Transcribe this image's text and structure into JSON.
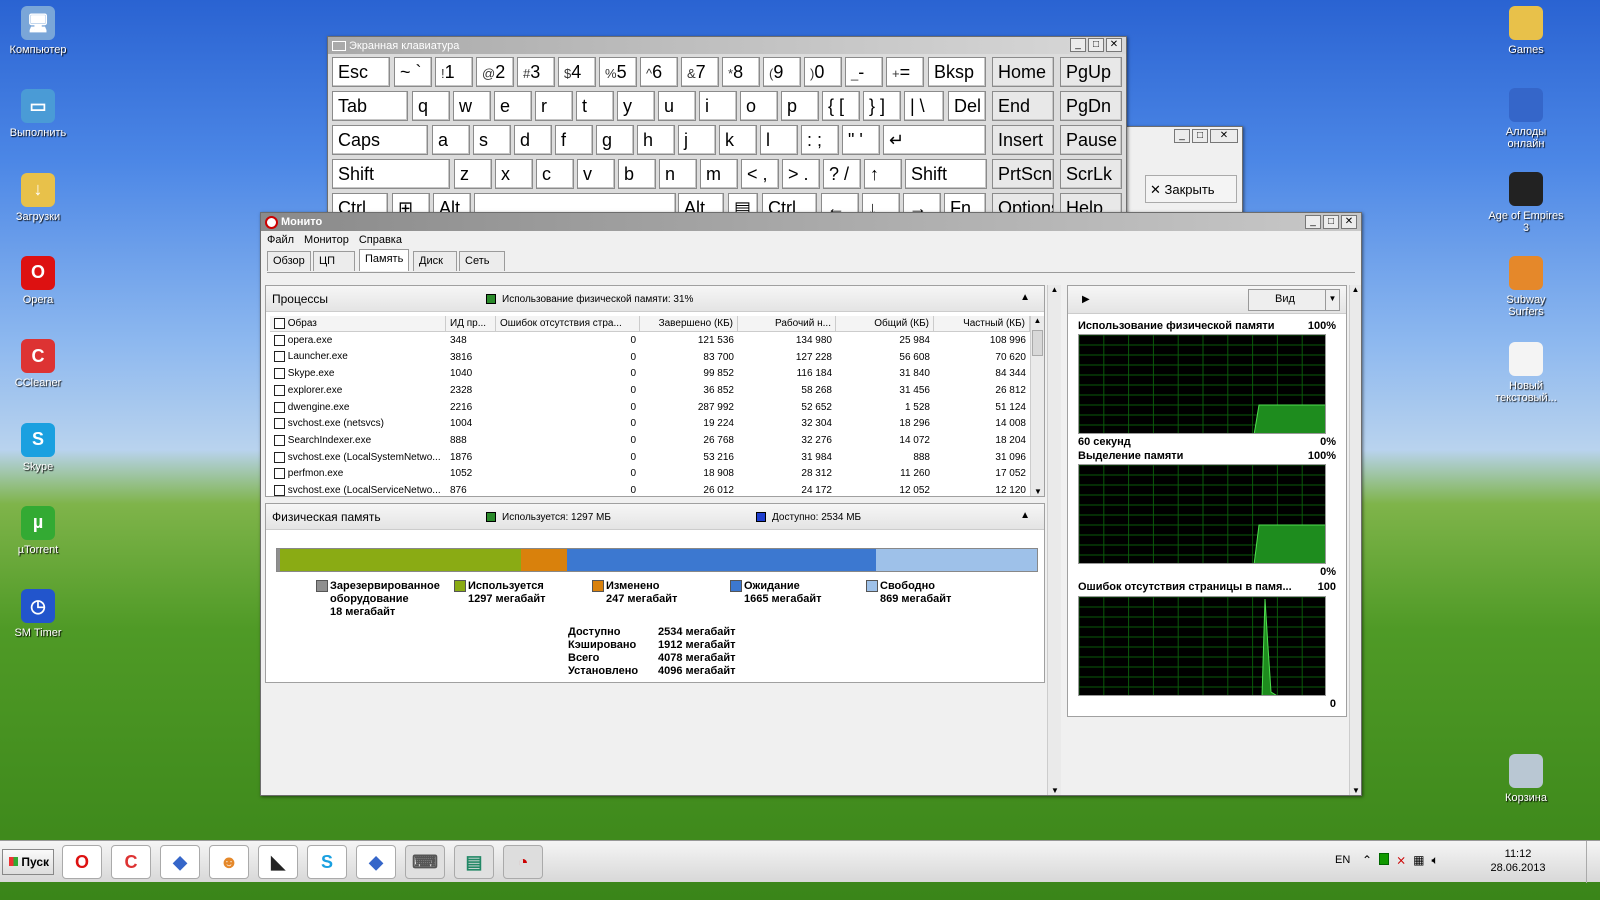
{
  "desktop": {
    "icons_left": [
      "Компьютер",
      "Выполнить",
      "Загрузки",
      "Opera",
      "CCleaner",
      "Skype",
      "µTorrent",
      "SM Timer"
    ],
    "icons_right": [
      "Games",
      "Аллоды онлайн",
      "Age of Empires 3",
      "Subway Surfers",
      "Новый текстовый...",
      "Корзина"
    ]
  },
  "osk": {
    "title": "Экранная клавиатура",
    "row1": [
      {
        "t": "Esc"
      },
      {
        "t": "~ `"
      },
      {
        "s": "!",
        "t": "1"
      },
      {
        "s": "@",
        "t": "2"
      },
      {
        "s": "#",
        "t": "3"
      },
      {
        "s": "$",
        "t": "4"
      },
      {
        "s": "%",
        "t": "5"
      },
      {
        "s": "^",
        "t": "6"
      },
      {
        "s": "&",
        "t": "7"
      },
      {
        "s": "*",
        "t": "8"
      },
      {
        "s": "(",
        "t": "9"
      },
      {
        "s": ")",
        "t": "0"
      },
      {
        "s": "_",
        "t": "-"
      },
      {
        "s": "+",
        "t": "="
      },
      {
        "t": "Bksp"
      },
      {
        "t": "Home"
      },
      {
        "t": "PgUp"
      }
    ],
    "row2": [
      "Tab",
      "q",
      "w",
      "e",
      "r",
      "t",
      "y",
      "u",
      "i",
      "o",
      "p",
      "{ [",
      "} ]",
      "| \\",
      "Del",
      "End",
      "PgDn"
    ],
    "row3": [
      "Caps",
      "a",
      "s",
      "d",
      "f",
      "g",
      "h",
      "j",
      "k",
      "l",
      ": ;",
      "\" '",
      "↵",
      "Insert",
      "Pause"
    ],
    "row4": [
      "Shift",
      "z",
      "x",
      "c",
      "v",
      "b",
      "n",
      "m",
      "< ,",
      "> .",
      "? /",
      "↑",
      "Shift",
      "PrtScn",
      "ScrLk"
    ],
    "row5": [
      "Ctrl",
      "⊞",
      "Alt",
      "",
      "Alt",
      "▤",
      "Ctrl",
      "←",
      "↓",
      "→",
      "Fn",
      "Options",
      "Help"
    ]
  },
  "bgwin": {
    "close_label": "✕  Закрыть"
  },
  "monitor": {
    "title": "Монито",
    "menu": [
      "Файл",
      "Монитор",
      "Справка"
    ],
    "tabs": [
      "Обзор",
      "ЦП",
      "Память",
      "Диск",
      "Сеть"
    ],
    "processes": {
      "title": "Процессы",
      "usage": "Использование физической памяти: 31%",
      "columns": [
        "Образ",
        "ИД пр...",
        "Ошибок отсутствия стра...",
        "Завершено (КБ)",
        "Рабочий н...",
        "Общий (КБ)",
        "Частный (КБ)"
      ],
      "rows": [
        [
          "opera.exe",
          "348",
          "0",
          "121 536",
          "134 980",
          "25 984",
          "108 996"
        ],
        [
          "Launcher.exe",
          "3816",
          "0",
          "83 700",
          "127 228",
          "56 608",
          "70 620"
        ],
        [
          "Skype.exe",
          "1040",
          "0",
          "99 852",
          "116 184",
          "31 840",
          "84 344"
        ],
        [
          "explorer.exe",
          "2328",
          "0",
          "36 852",
          "58 268",
          "31 456",
          "26 812"
        ],
        [
          "dwengine.exe",
          "2216",
          "0",
          "287 992",
          "52 652",
          "1 528",
          "51 124"
        ],
        [
          "svchost.exe (netsvcs)",
          "1004",
          "0",
          "19 224",
          "32 304",
          "18 296",
          "14 008"
        ],
        [
          "SearchIndexer.exe",
          "888",
          "0",
          "26 768",
          "32 276",
          "14 072",
          "18 204"
        ],
        [
          "svchost.exe (LocalSystemNetwo...",
          "1876",
          "0",
          "53 216",
          "31 984",
          "888",
          "31 096"
        ],
        [
          "perfmon.exe",
          "1052",
          "0",
          "18 908",
          "28 312",
          "11 260",
          "17 052"
        ],
        [
          "svchost.exe (LocalServiceNetwo...",
          "876",
          "0",
          "26 012",
          "24 172",
          "12 052",
          "12 120"
        ]
      ]
    },
    "physmem": {
      "title": "Физическая память",
      "used": "Используется: 1297 МБ",
      "avail": "Доступно: 2534 МБ",
      "bar": [
        {
          "name": "reserved",
          "mb": 18,
          "color": "#8f8f8f"
        },
        {
          "name": "used",
          "mb": 1297,
          "color": "#8aab14"
        },
        {
          "name": "modified",
          "mb": 247,
          "color": "#d9810c"
        },
        {
          "name": "standby",
          "mb": 1665,
          "color": "#3c78d0"
        },
        {
          "name": "free",
          "mb": 869,
          "color": "#9ec1e9"
        }
      ],
      "legend": [
        {
          "l1": "Зарезервированное",
          "l2": "оборудование",
          "l3": "18 мегабайт"
        },
        {
          "l1": "Используется",
          "l2": "1297 мегабайт"
        },
        {
          "l1": "Изменено",
          "l2": "247 мегабайт"
        },
        {
          "l1": "Ожидание",
          "l2": "1665 мегабайт"
        },
        {
          "l1": "Свободно",
          "l2": "869 мегабайт"
        }
      ],
      "stats": [
        [
          "Доступно",
          "2534 мегабайт"
        ],
        [
          "Кэшировано",
          "1912 мегабайт"
        ],
        [
          "Всего",
          "4078 мегабайт"
        ],
        [
          "Установлено",
          "4096 мегабайт"
        ]
      ]
    },
    "side": {
      "view_label": "Вид",
      "g1": {
        "title": "Использование физической памяти",
        "max": "100%",
        "foot_left": "60 секунд",
        "foot_right": "0%"
      },
      "g2": {
        "title": "Выделение памяти",
        "max": "100%",
        "foot_right": "0%"
      },
      "g3": {
        "title": "Ошибок отсутствия страницы в памя...",
        "max": "100",
        "foot_right": "0"
      }
    }
  },
  "taskbar": {
    "start": "Пуск",
    "lang": "EN",
    "time": "11:12",
    "date": "28.06.2013"
  }
}
